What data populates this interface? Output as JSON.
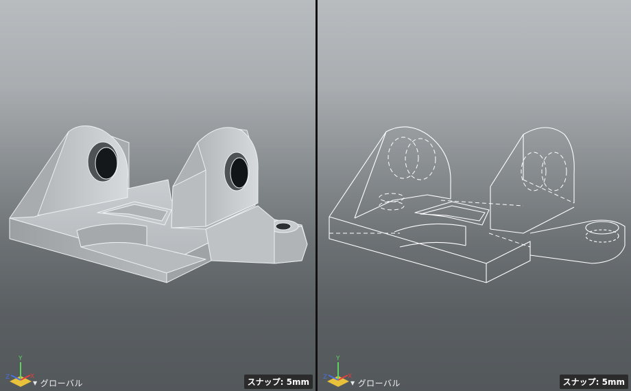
{
  "viewports": [
    {
      "id": "left",
      "render_mode": "shaded",
      "coordinate_system": "グローバル",
      "snap_label": "スナップ: 5mm",
      "axis_labels": {
        "x": "X",
        "y": "Y",
        "z": "Z"
      }
    },
    {
      "id": "right",
      "render_mode": "wireframe",
      "coordinate_system": "グローバル",
      "snap_label": "スナップ: 5mm",
      "axis_labels": {
        "x": "X",
        "y": "Y",
        "z": "Z"
      }
    }
  ],
  "colors": {
    "axis_x": "#e04040",
    "axis_y": "#5fd35f",
    "axis_z": "#4a6fe0",
    "axis_plane": "#e8c23a",
    "wire": "#ffffff",
    "snap_bg": "#2b2b2b"
  }
}
